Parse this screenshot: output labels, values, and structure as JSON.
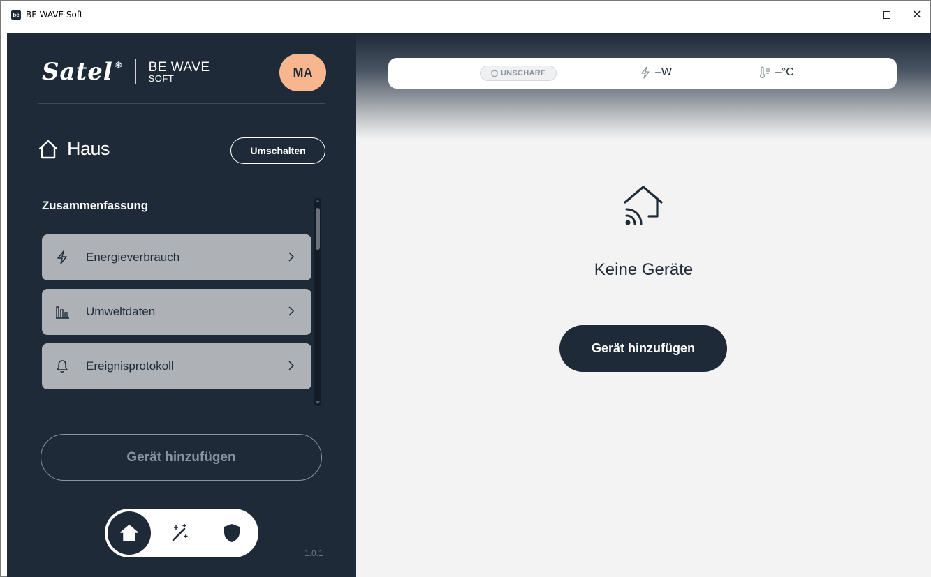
{
  "window": {
    "app_icon_text": "be",
    "title": "BE WAVE Soft",
    "minimize_icon": "minimize-icon",
    "maximize_icon": "maximize-icon",
    "close_icon": "close-icon",
    "close_glyph": "✕"
  },
  "sidebar": {
    "logo": {
      "brand": "Satel",
      "product_line1": "BE WAVE",
      "product_line2": "SOFT"
    },
    "avatar_initials": "MA",
    "location": {
      "title": "Haus",
      "switch_label": "Umschalten"
    },
    "summary": {
      "title": "Zusammenfassung",
      "items": [
        {
          "label": "Energieverbrauch",
          "icon": "lightning-icon"
        },
        {
          "label": "Umweltdaten",
          "icon": "bar-chart-icon"
        },
        {
          "label": "Ereignisprotokoll",
          "icon": "bell-icon"
        }
      ]
    },
    "add_device_label": "Gerät hinzufügen",
    "bottom_nav": {
      "items": [
        "home-icon",
        "magic-wand-icon",
        "shield-icon"
      ],
      "active": "home-icon"
    },
    "version": "1.0.1"
  },
  "status_bar": {
    "arm_status": "UNSCHARF",
    "power": "–W",
    "temperature": "–°C"
  },
  "main": {
    "empty_title": "Keine Geräte",
    "add_device_label": "Gerät hinzufügen"
  },
  "colors": {
    "navy": "#1e2a38",
    "avatar": "#f7b68e",
    "summary_item_bg": "#aeb1b5",
    "main_bg": "#f3f3f3"
  }
}
